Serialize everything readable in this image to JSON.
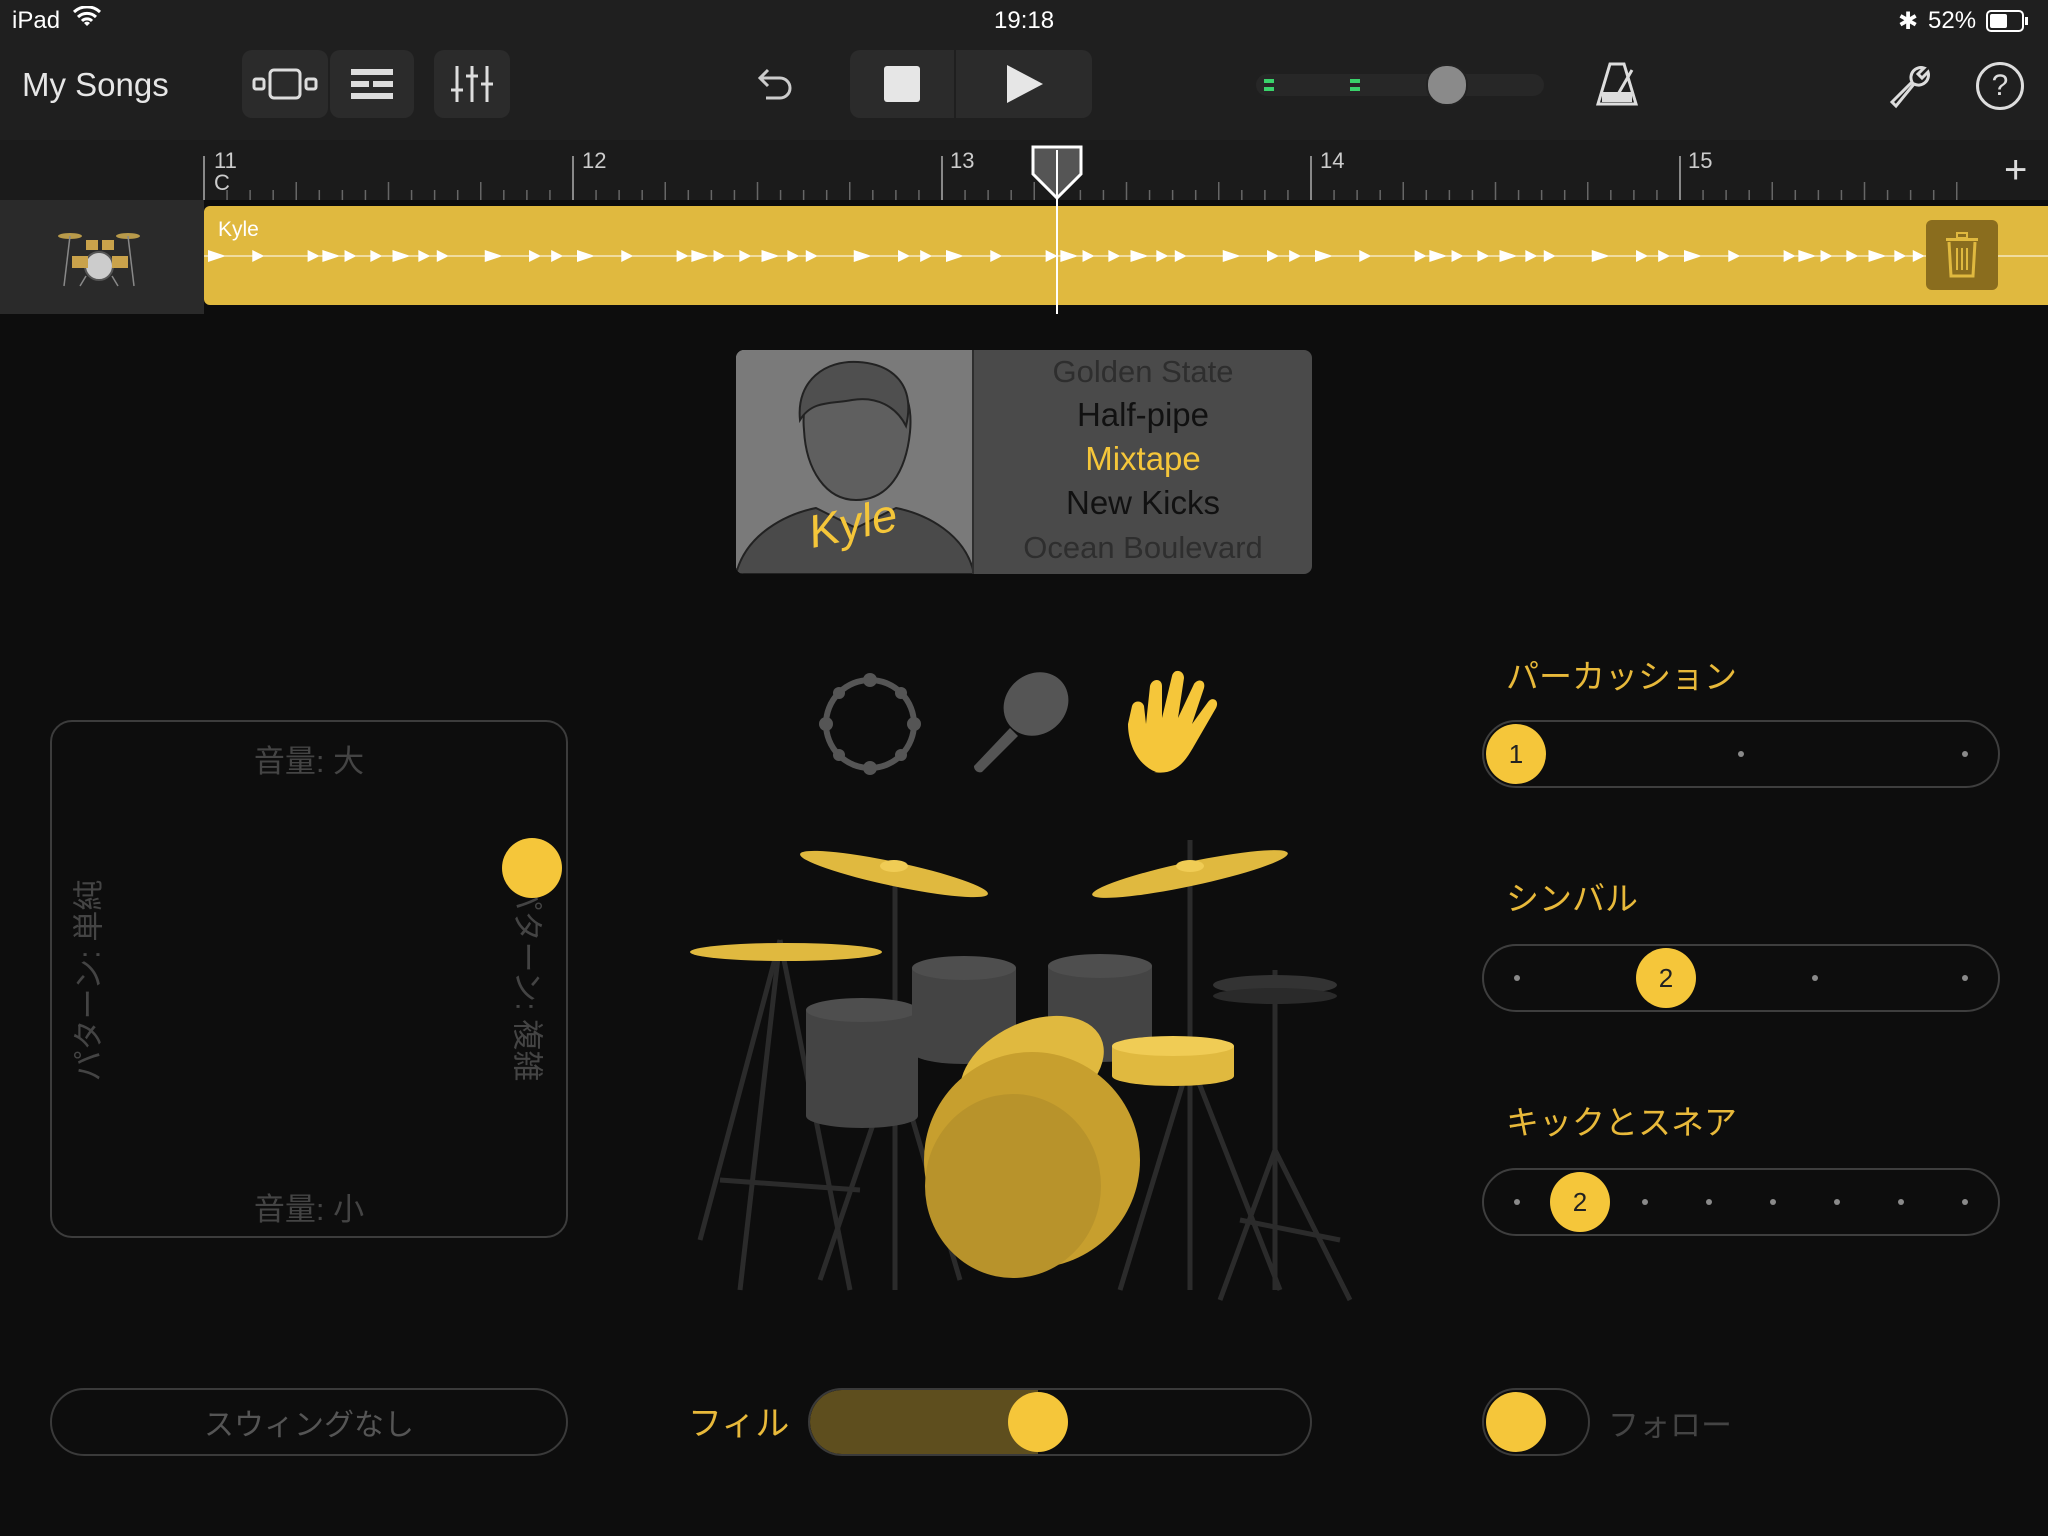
{
  "status_bar": {
    "device": "iPad",
    "time": "19:18",
    "battery": "52%"
  },
  "toolbar": {
    "my_songs": "My Songs"
  },
  "ruler": {
    "bars": [
      "11",
      "12",
      "13",
      "14",
      "15"
    ],
    "key": "C"
  },
  "track": {
    "region_name": "Kyle"
  },
  "drummer": {
    "signature": "Kyle",
    "styles": [
      "Golden State",
      "Half-pipe",
      "Mixtape",
      "New Kicks",
      "Ocean Boulevard"
    ],
    "selected_style": "Mixtape"
  },
  "xy_pad": {
    "top": "音量: 大",
    "bottom": "音量: 小",
    "left": "パターン: 単純",
    "right": "パターン: 複雑"
  },
  "controls": {
    "percussion": {
      "label": "パーカッション",
      "value": "1",
      "steps": 3,
      "index": 0
    },
    "cymbal": {
      "label": "シンバル",
      "value": "2",
      "steps": 4,
      "index": 1
    },
    "kick_snare": {
      "label": "キックとスネア",
      "value": "2",
      "steps": 8,
      "index": 1
    }
  },
  "bottom": {
    "swing": "スウィングなし",
    "fill": "フィル",
    "fill_level": 0.45,
    "follow": "フォロー"
  },
  "colors": {
    "accent": "#f5c63a",
    "region": "#e0b93f"
  }
}
